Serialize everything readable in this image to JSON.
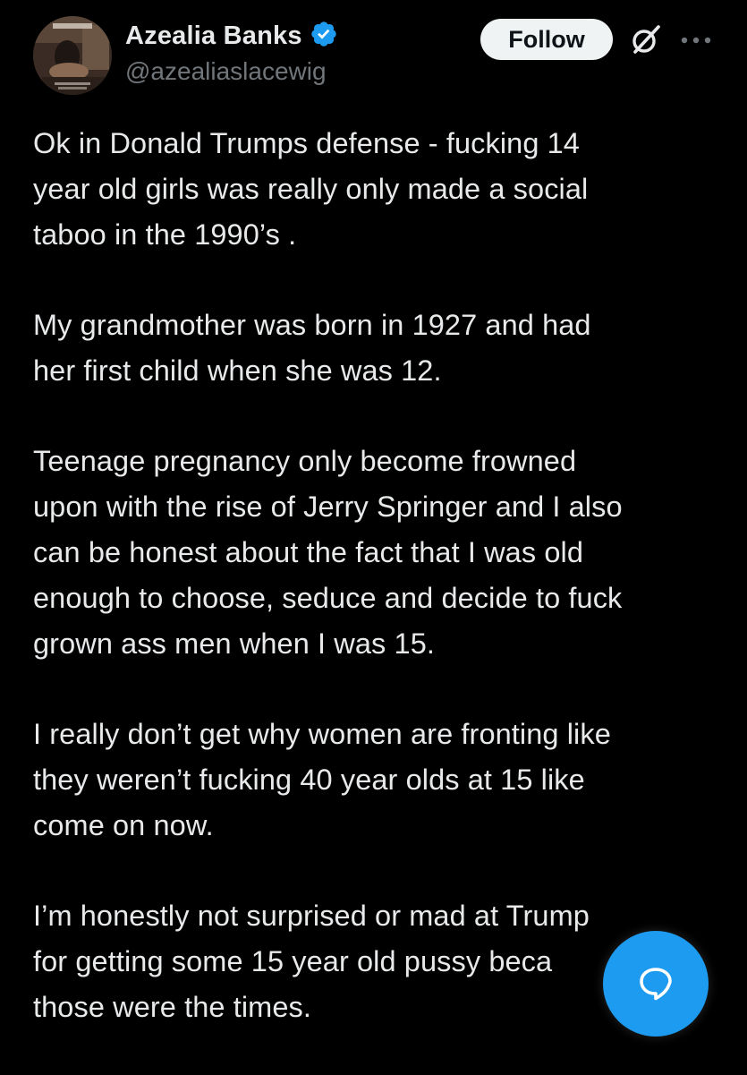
{
  "author": {
    "display_name": "Azealia Banks",
    "handle": "@azealiaslacewig",
    "verified": true,
    "avatar_icon": "profile-photo"
  },
  "actions": {
    "follow_label": "Follow",
    "grok_icon": "grok-icon",
    "more_icon": "more-options-icon"
  },
  "tweet": {
    "paragraphs": [
      "Ok in Donald Trumps defense - fucking 14\nyear old girls was really only made a social\ntaboo in the 1990’s .",
      "My grandmother was born in 1927 and had\nher first child when she was 12.",
      "Teenage pregnancy only become frowned\nupon with the rise of Jerry Springer and I also\ncan be honest about the fact that I was old\nenough to choose, seduce and decide to fuck\ngrown ass men when I was 15.",
      "I really don’t get why women are fronting like\nthey weren’t fucking 40 year olds at 15 like\ncome on now.",
      "I’m honestly not surprised or mad at Trump\nfor getting some 15 year old pussy beca\nthose were the times."
    ]
  },
  "fab": {
    "icon": "reply-bubble-icon"
  },
  "colors": {
    "background": "#000000",
    "text": "#e7e9ea",
    "secondary_text": "#71767b",
    "accent": "#1d9bf0",
    "follow_bg": "#eff3f4"
  }
}
